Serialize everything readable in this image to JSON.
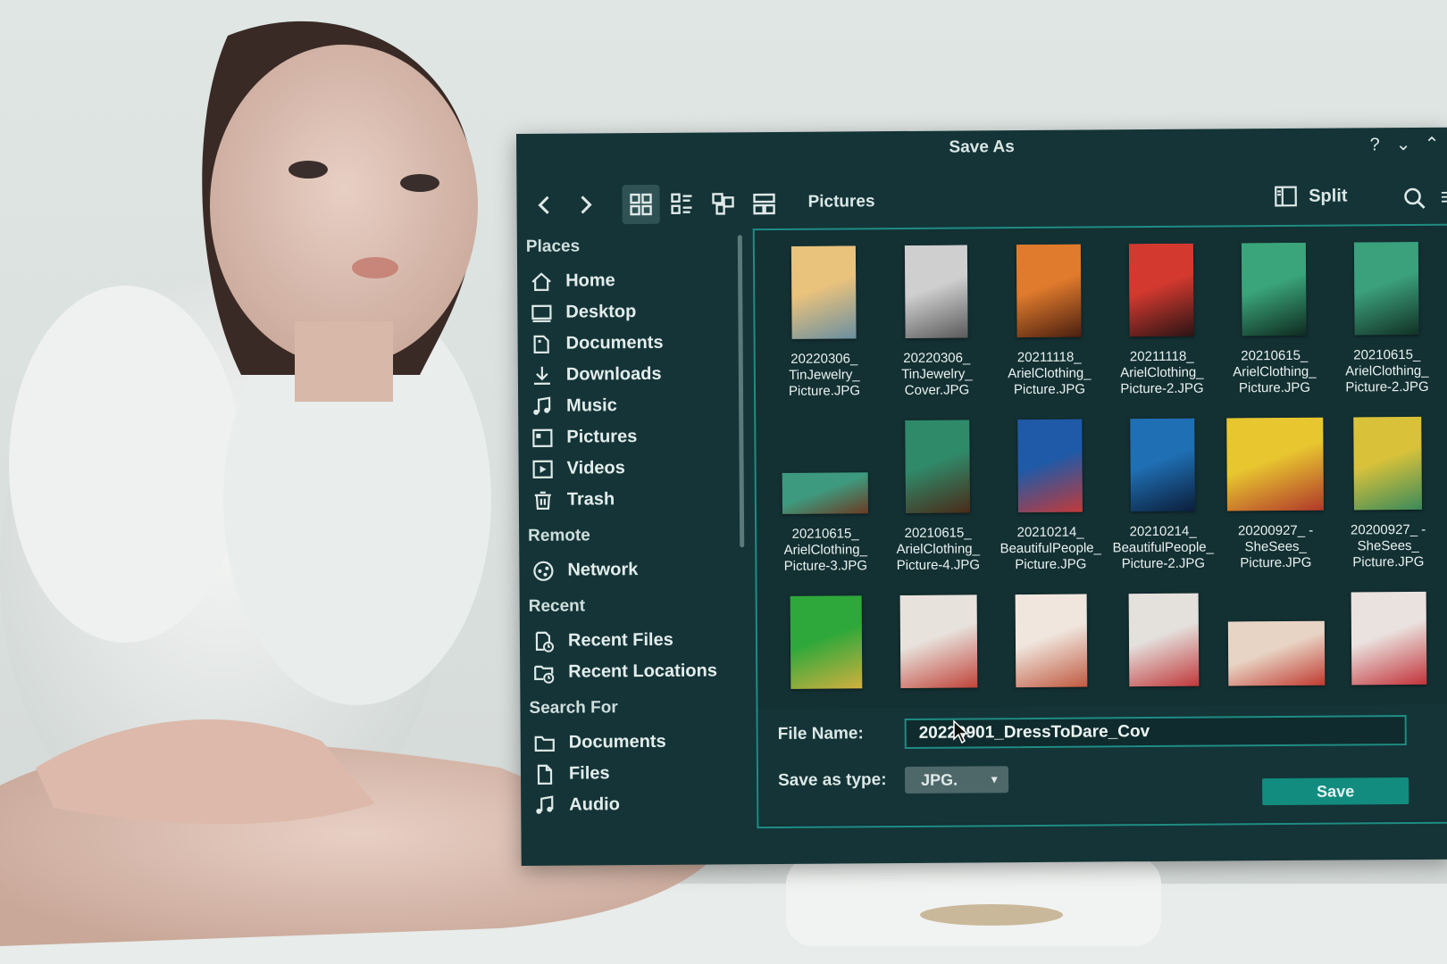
{
  "dialog": {
    "title": "Save As",
    "controls": [
      "?",
      "⌄",
      "⌃"
    ]
  },
  "toolbar": {
    "back_icon": "chevron-left-icon",
    "forward_icon": "chevron-right-icon",
    "location": "Pictures",
    "split_label": "Split"
  },
  "sidebar": {
    "places_heading": "Places",
    "places": [
      {
        "label": "Home",
        "icon": "home-icon"
      },
      {
        "label": "Desktop",
        "icon": "desktop-icon"
      },
      {
        "label": "Documents",
        "icon": "documents-icon"
      },
      {
        "label": "Downloads",
        "icon": "download-icon"
      },
      {
        "label": "Music",
        "icon": "music-icon"
      },
      {
        "label": "Pictures",
        "icon": "picture-icon"
      },
      {
        "label": "Videos",
        "icon": "video-icon"
      },
      {
        "label": "Trash",
        "icon": "trash-icon"
      }
    ],
    "remote_heading": "Remote",
    "remote": [
      {
        "label": "Network",
        "icon": "network-icon"
      }
    ],
    "recent_heading": "Recent",
    "recent": [
      {
        "label": "Recent Files",
        "icon": "recent-file-icon"
      },
      {
        "label": "Recent Locations",
        "icon": "recent-folder-icon"
      }
    ],
    "search_heading": "Search For",
    "search": [
      {
        "label": "Documents",
        "icon": "folder-icon"
      },
      {
        "label": "Files",
        "icon": "file-icon"
      },
      {
        "label": "Audio",
        "icon": "music-icon"
      }
    ]
  },
  "files": [
    {
      "name": "20220306_ TinJewelry_ Picture.JPG",
      "colors": [
        "#e9c27c",
        "#6a8fa0"
      ]
    },
    {
      "name": "20220306_ TinJewelry_ Cover.JPG",
      "colors": [
        "#cfcfcf",
        "#5a5a5a"
      ]
    },
    {
      "name": "20211118_ ArielClothing_ Picture.JPG",
      "colors": [
        "#e07a2c",
        "#4a1f10"
      ]
    },
    {
      "name": "20211118_ ArielClothing_ Picture-2.JPG",
      "colors": [
        "#d4392f",
        "#2a1414"
      ]
    },
    {
      "name": "20210615_ ArielClothing_ Picture.JPG",
      "colors": [
        "#3aa57a",
        "#0f2a20"
      ]
    },
    {
      "name": "20210615_ ArielClothing_ Picture-2.JPG",
      "colors": [
        "#3ba07c",
        "#123025"
      ]
    },
    {
      "name": "20210615_ ArielClothing_ Picture-3.JPG",
      "colors": [
        "#3e9a7f",
        "#6b3a22"
      ]
    },
    {
      "name": "20210615_ ArielClothing_ Picture-4.JPG",
      "colors": [
        "#2f8a6a",
        "#4a2a18"
      ]
    },
    {
      "name": "20210214_ BeautifulPeople_ Picture.JPG",
      "colors": [
        "#1e5aa8",
        "#c23a3a"
      ]
    },
    {
      "name": "20210214_ BeautifulPeople_ Picture-2.JPG",
      "colors": [
        "#1f6fb4",
        "#0b1e3a"
      ]
    },
    {
      "name": "20200927_ - SheSees_ Picture.JPG",
      "colors": [
        "#e8c630",
        "#b0382a"
      ]
    },
    {
      "name": "20200927_ - SheSees_ Picture.JPG",
      "colors": [
        "#d9c23a",
        "#3a8a5a"
      ]
    },
    {
      "name": "",
      "colors": [
        "#2ea83a",
        "#d0b040"
      ]
    },
    {
      "name": "",
      "colors": [
        "#e8e2dc",
        "#c0443a"
      ]
    },
    {
      "name": "",
      "colors": [
        "#f0e6de",
        "#c05a40"
      ]
    },
    {
      "name": "",
      "colors": [
        "#e4e0dc",
        "#c0383a"
      ]
    },
    {
      "name": "",
      "colors": [
        "#e8d4c4",
        "#c03a30"
      ]
    },
    {
      "name": "",
      "colors": [
        "#eae2de",
        "#c2323a"
      ]
    }
  ],
  "form": {
    "file_name_label": "File Name:",
    "file_name_value": "20220901_DressToDare_Cov",
    "save_type_label": "Save as type:",
    "save_type_value": "JPG.",
    "save_button": "Save"
  }
}
